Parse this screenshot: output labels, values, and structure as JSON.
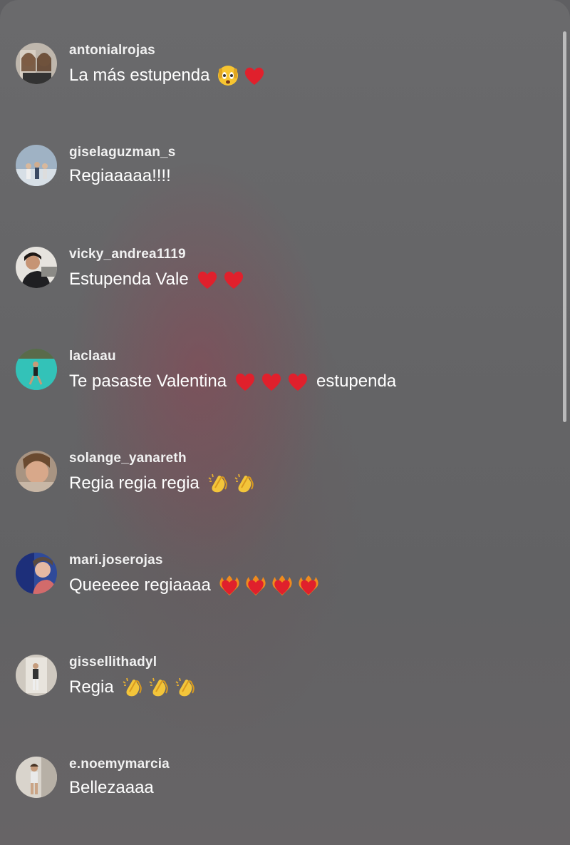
{
  "comments": [
    {
      "username": "antonialrojas",
      "text": "La más estupenda",
      "emojis": [
        "face-peeking-emoji",
        "red-heart-emoji"
      ],
      "after": ""
    },
    {
      "username": "giselaguzman_s",
      "text": "Regiaaaaa!!!!",
      "emojis": [],
      "after": ""
    },
    {
      "username": "vicky_andrea1119",
      "text": "Estupenda Vale",
      "emojis": [
        "red-heart-emoji",
        "red-heart-emoji"
      ],
      "after": ""
    },
    {
      "username": "laclaau",
      "text": "Te pasaste Valentina",
      "emojis": [
        "red-heart-emoji",
        "red-heart-emoji",
        "red-heart-emoji"
      ],
      "after": "estupenda"
    },
    {
      "username": "solange_yanareth",
      "text": "Regia regia regia",
      "emojis": [
        "clapping-hands-emoji",
        "clapping-hands-emoji"
      ],
      "after": ""
    },
    {
      "username": "mari.joserojas",
      "text": "Queeeee regiaaaa",
      "emojis": [
        "heart-on-fire-emoji",
        "heart-on-fire-emoji",
        "heart-on-fire-emoji",
        "heart-on-fire-emoji"
      ],
      "after": ""
    },
    {
      "username": "gissellithadyl",
      "text": "Regia",
      "emojis": [
        "clapping-hands-emoji",
        "clapping-hands-emoji",
        "clapping-hands-emoji"
      ],
      "after": ""
    },
    {
      "username": "e.noemymarcia",
      "text": "Bellezaaaa",
      "emojis": [],
      "after": ""
    }
  ]
}
